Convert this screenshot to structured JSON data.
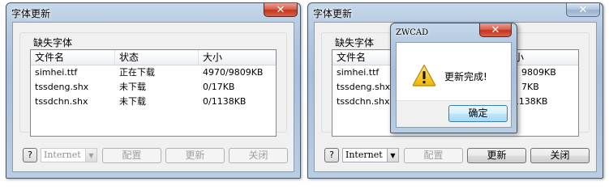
{
  "left_window": {
    "title": "字体更新",
    "group_label": "缺失字体",
    "columns": [
      "文件名",
      "状态",
      "大小"
    ],
    "rows": [
      {
        "file": "simhei.ttf",
        "status": "正在下载",
        "size": "4970/9809KB"
      },
      {
        "file": "tssdeng.shx",
        "status": "未下载",
        "size": "0/17KB"
      },
      {
        "file": "tssdchn.shx",
        "status": "未下载",
        "size": "0/1138KB"
      }
    ],
    "help_label": "?",
    "source_select_value": "Internet",
    "configure_label": "配置",
    "update_label": "更新",
    "close_label": "关闭",
    "close_glyph": "✕"
  },
  "right_window": {
    "title": "字体更新",
    "group_label": "缺失字体",
    "columns": [
      "文件名",
      "状态",
      "大小"
    ],
    "rows": [
      {
        "file": "simhei.ttf",
        "status": "",
        "size": "9809KB"
      },
      {
        "file": "tssdeng.shx",
        "status": "",
        "size": "7KB"
      },
      {
        "file": "tssdchn.shx",
        "status": "",
        "size": "0/1138KB"
      }
    ],
    "help_label": "?",
    "source_select_value": "Internet",
    "configure_label": "配置",
    "update_label": "更新",
    "close_label": "关闭",
    "close_glyph": "✕"
  },
  "message_box": {
    "title": "ZWCAD",
    "message": "更新完成!",
    "ok_label": "确定",
    "close_glyph": "✕",
    "icon": "warning-icon"
  },
  "colors": {
    "warning_yellow": "#f5c400",
    "close_red": "#c7432c",
    "accent_blue": "#3c7fb1"
  }
}
